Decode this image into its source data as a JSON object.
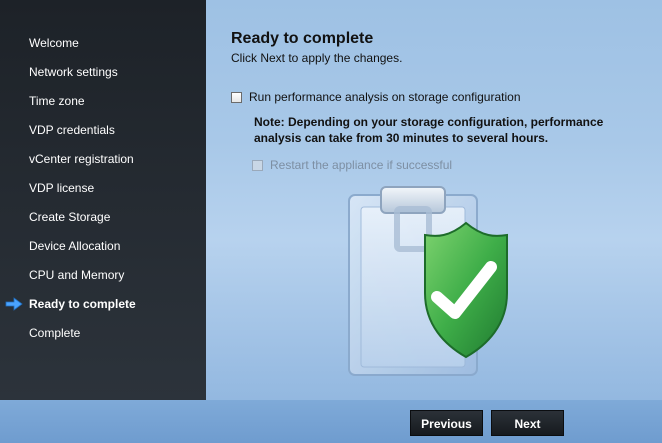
{
  "sidebar": {
    "items": [
      {
        "label": "Welcome"
      },
      {
        "label": "Network settings"
      },
      {
        "label": "Time zone"
      },
      {
        "label": "VDP credentials"
      },
      {
        "label": "vCenter registration"
      },
      {
        "label": "VDP license"
      },
      {
        "label": "Create Storage"
      },
      {
        "label": "Device Allocation"
      },
      {
        "label": "CPU and Memory"
      },
      {
        "label": "Ready to complete",
        "active": true
      },
      {
        "label": "Complete"
      }
    ]
  },
  "main": {
    "title": "Ready to complete",
    "subtitle": "Click Next to apply the changes.",
    "perf_checkbox": {
      "label": "Run performance analysis on storage configuration",
      "checked": false
    },
    "note": "Note: Depending on your storage configuration, performance analysis can take from 30 minutes to several hours.",
    "restart_checkbox": {
      "label": "Restart the appliance if successful",
      "checked": false,
      "disabled": true
    }
  },
  "footer": {
    "previous_label": "Previous",
    "next_label": "Next"
  },
  "icons": {
    "active_step": "arrow-right-icon",
    "illustration": "clipboard-shield-check-icon"
  },
  "colors": {
    "sidebar_bg": "#1d2228",
    "active_arrow": "#4aa3ff",
    "shield_green": "#3fae49"
  }
}
